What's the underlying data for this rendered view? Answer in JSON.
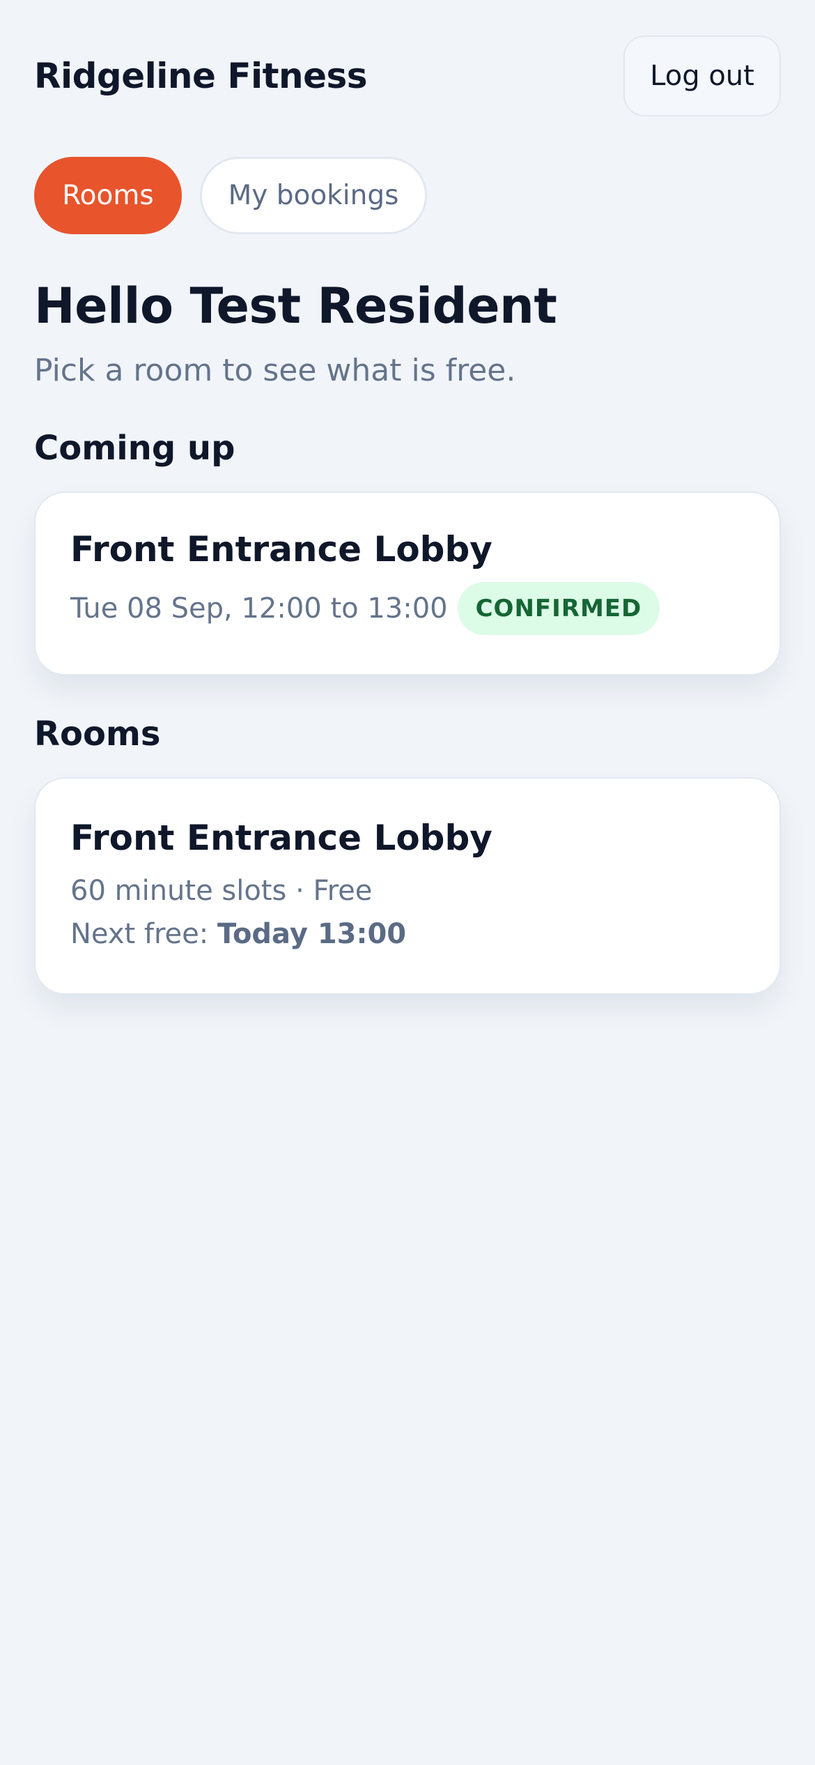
{
  "header": {
    "brand": "Ridgeline Fitness",
    "logout_label": "Log out"
  },
  "tabs": [
    {
      "label": "Rooms",
      "active": true
    },
    {
      "label": "My bookings",
      "active": false
    }
  ],
  "greeting": "Hello Test Resident",
  "subtitle": "Pick a room to see what is free.",
  "coming_up": {
    "title": "Coming up",
    "booking": {
      "room": "Front Entrance Lobby",
      "time": "Tue 08 Sep, 12:00 to 13:00",
      "status": "CONFIRMED"
    }
  },
  "rooms": {
    "title": "Rooms",
    "items": [
      {
        "name": "Front Entrance Lobby",
        "meta": "60 minute slots · Free",
        "next_label": "Next free:",
        "next_value": "Today 13:00"
      }
    ]
  },
  "colors": {
    "accent": "#e8542c",
    "background": "#f1f5fa",
    "confirmed_bg": "#dcfce7",
    "confirmed_text": "#166534"
  }
}
